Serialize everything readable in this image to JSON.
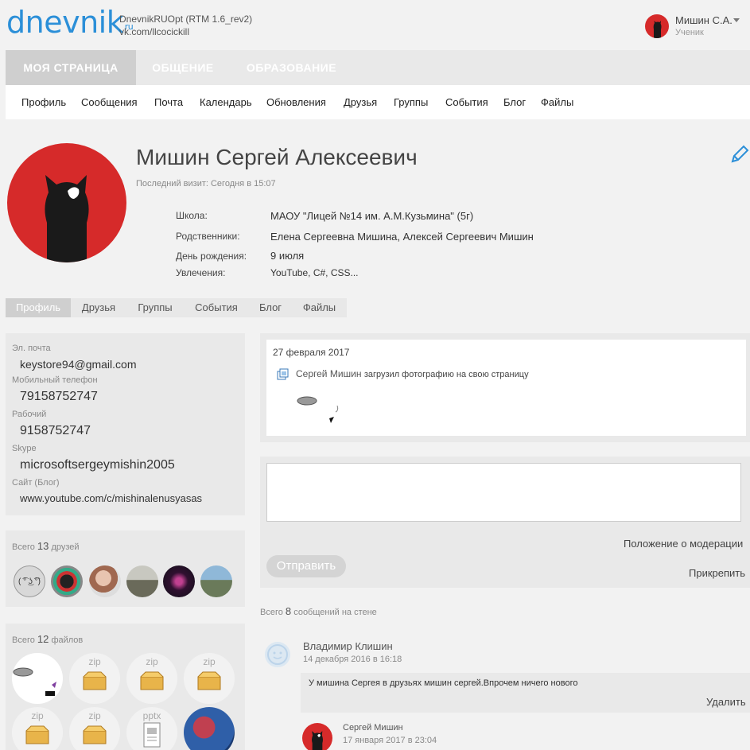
{
  "header": {
    "logo": "dnevnik",
    "logo_suffix": "ru",
    "app_title": "DnevnikRUOpt (RTM 1.6_rev2)",
    "app_link": "vk.com/llcocickill",
    "user_name": "Мишин С.А.",
    "user_role": "Ученик"
  },
  "main_nav": [
    {
      "label": "МОЯ СТРАНИЦА",
      "active": true
    },
    {
      "label": "ОБЩЕНИЕ",
      "active": false
    },
    {
      "label": "ОБРАЗОВАНИЕ",
      "active": false
    }
  ],
  "sub_nav": [
    "Профиль",
    "Сообщения",
    "Почта",
    "Календарь",
    "Обновления",
    "Друзья",
    "Группы",
    "События",
    "Блог",
    "Файлы"
  ],
  "profile": {
    "name": "Мишин Сергей Алексеевич",
    "last_visit": "Последний визит: Сегодня в 15:07",
    "info": [
      {
        "label": "Школа:",
        "value": "МАОУ \"Лицей №14 им. А.М.Кузьмина\" (5г)"
      },
      {
        "label": "Родственники:",
        "value": "Елена Сергеевна Мишина, Алексей Сергеевич Мишин"
      },
      {
        "label": "День рождения:",
        "value": "9 июля"
      },
      {
        "label": "Увлечения:",
        "value": "YouTube, C#, CSS..."
      }
    ]
  },
  "profile_tabs": [
    {
      "label": "Профиль",
      "active": true
    },
    {
      "label": "Друзья",
      "active": false
    },
    {
      "label": "Группы",
      "active": false
    },
    {
      "label": "События",
      "active": false
    },
    {
      "label": "Блог",
      "active": false
    },
    {
      "label": "Файлы",
      "active": false
    }
  ],
  "contacts": [
    {
      "label": "Эл. почта",
      "value": "keystore94@gmail.com"
    },
    {
      "label": "Мобильный телефон",
      "value": "79158752747"
    },
    {
      "label": "Рабочий",
      "value": "9158752747"
    },
    {
      "label": "Skype",
      "value": "microsoftsergeymishin2005"
    },
    {
      "label": "Сайт (Блог)",
      "value": "www.youtube.com/c/mishinalenusyasas"
    }
  ],
  "friends": {
    "prefix": "Всего",
    "count": "13",
    "suffix": "друзей",
    "avatar_text": "( ͡° ͜ʖ ͡°)"
  },
  "files": {
    "prefix": "Всего",
    "count": "12",
    "suffix": "файлов",
    "items": [
      "",
      "zip",
      "zip",
      "zip",
      "zip",
      "zip",
      "pptx",
      ""
    ]
  },
  "feed": {
    "date": "27 февраля 2017",
    "author": "Сергей Мишин",
    "action": "загрузил фотографию на свою страницу"
  },
  "post_form": {
    "moderation_link": "Положение о модерации",
    "send_label": "Отправить",
    "attach_label": "Прикрепить"
  },
  "wall": {
    "prefix": "Всего",
    "count": "8",
    "suffix": "сообщений на стене",
    "post": {
      "author": "Владимир Клишин",
      "date": "14 декабря 2016 в 16:18",
      "text": "У мишина Сергея в друзьях мишин сергей.Впрочем ничего нового",
      "delete_label": "Удалить"
    },
    "reply": {
      "author": "Сергей Мишин",
      "date": "17 января 2017 в 23:04"
    }
  },
  "colors": {
    "accent": "#2b8fd8",
    "avatar_bg": "#d62a2a",
    "panel_bg": "#e9e9e9"
  }
}
